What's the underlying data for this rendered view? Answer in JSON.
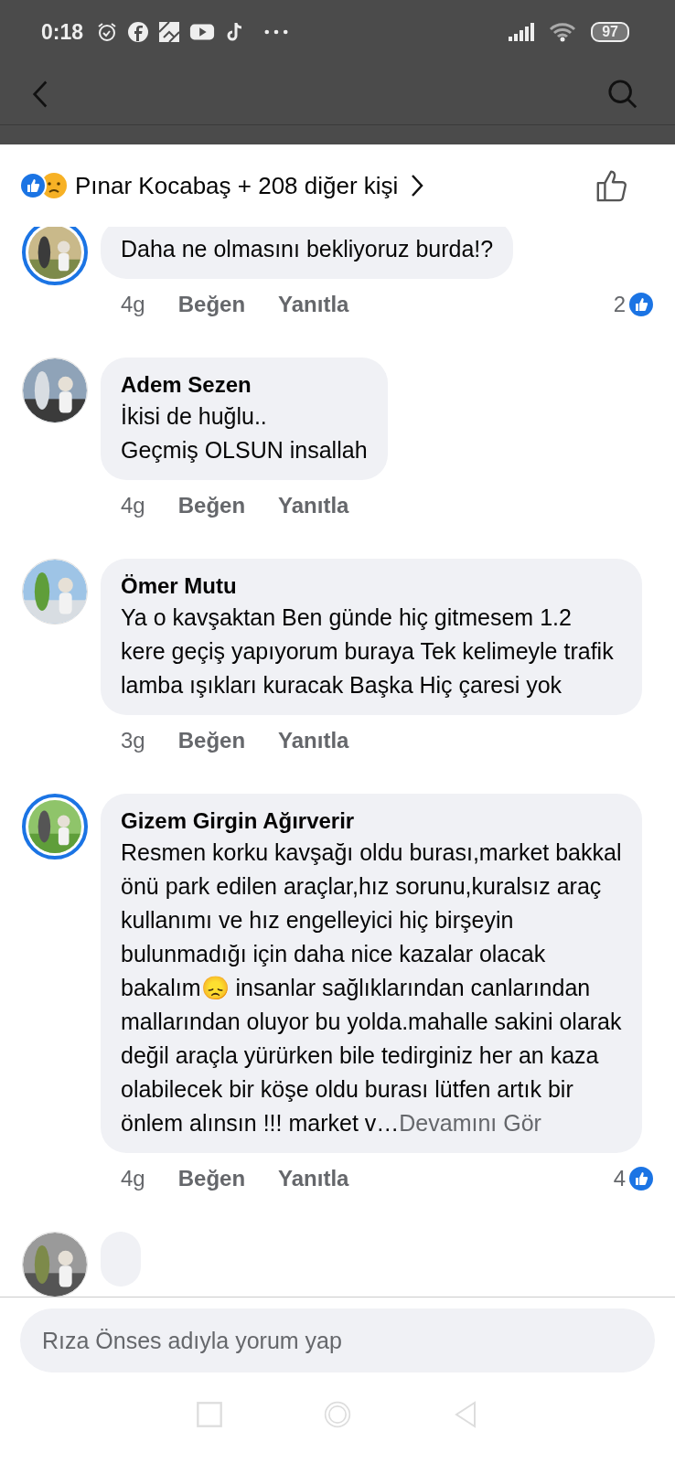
{
  "status_bar": {
    "time": "0:18",
    "battery": "97"
  },
  "reactions": {
    "summary": "Pınar Kocabaş + 208 diğer kişi"
  },
  "comments": [
    {
      "ring": true,
      "text": "Daha ne olmasını bekliyoruz burda!?",
      "time": "4g",
      "like": "Beğen",
      "reply": "Yanıtla",
      "count": "2"
    },
    {
      "author": "Adem Sezen",
      "ring": false,
      "text": "İkisi de huğlu..\nGeçmiş OLSUN insallah",
      "time": "4g",
      "like": "Beğen",
      "reply": "Yanıtla"
    },
    {
      "author": "Ömer Mutu",
      "ring": false,
      "text": "Ya o kavşaktan Ben günde hiç gitmesem 1.2 kere geçiş yapıyorum buraya Tek kelimeyle trafik lamba ışıkları kuracak Başka Hiç çaresi yok",
      "time": "3g",
      "like": "Beğen",
      "reply": "Yanıtla"
    },
    {
      "author": "Gizem Girgin Ağırverir",
      "ring": true,
      "text": "Resmen korku kavşağı oldu burası,market bakkal önü park edilen araçlar,hız sorunu,kuralsız araç kullanımı ve hız engelleyici hiç birşeyin bulunmadığı için daha nice kazalar olacak bakalım😞 insanlar sağlıklarından canlarından mallarından oluyor bu yolda.mahalle sakini olarak değil araçla yürürken bile tedirginiz her an kaza olabilecek bir köşe oldu burası lütfen artık bir önlem alınsın !!! market v…",
      "more": "Devamını Gör",
      "time": "4g",
      "like": "Beğen",
      "reply": "Yanıtla",
      "count": "4"
    },
    {
      "ring": false
    }
  ],
  "composer": {
    "placeholder": "Rıza Önses adıyla yorum yap"
  }
}
